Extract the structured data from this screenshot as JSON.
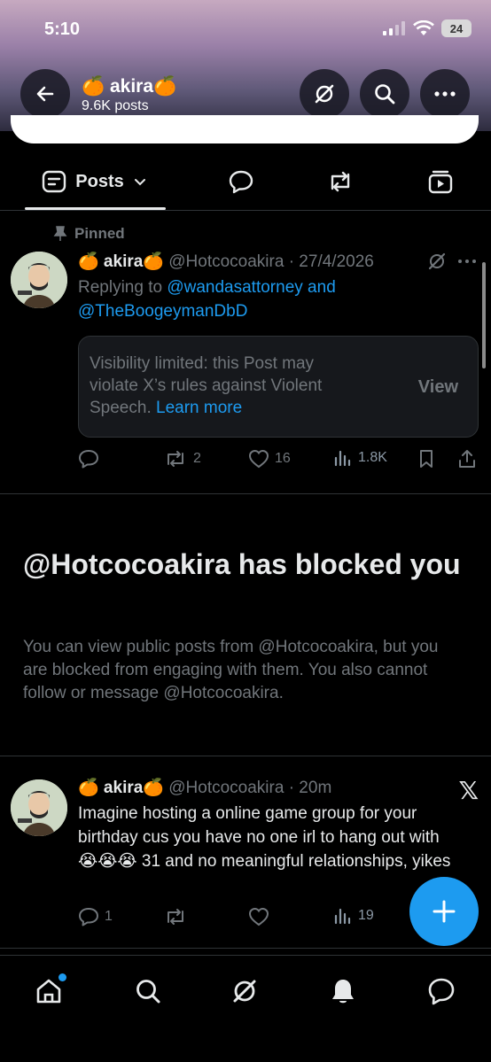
{
  "status_bar": {
    "time": "5:10",
    "battery": "24"
  },
  "header": {
    "name": "🍊 akira🍊",
    "posts_count": "9.6K posts"
  },
  "tabs": {
    "posts_label": "Posts"
  },
  "pinned_post": {
    "pinned_label": "Pinned",
    "display_name": "🍊 akira🍊",
    "handle_date": "@Hotcocoakira · 27/4/2026",
    "replying_prefix": "Replying to ",
    "reply_mention_1": "@wandasattorney",
    "reply_and": " and",
    "reply_mention_2": "@TheBoogeymanDbD",
    "limited_text": "Visibility limited: this Post may violate X’s rules against Violent Speech.",
    "learn_more": "Learn more",
    "view_label": "View",
    "reposts": "2",
    "likes": "16",
    "views": "1.8K"
  },
  "blocked": {
    "title": "@Hotcocoakira has blocked you",
    "text": "You can view public posts from @Hotcocoakira, but you are blocked from engaging with them. You also cannot follow or message @Hotcocoakira."
  },
  "second_post": {
    "display_name": "🍊 akira🍊",
    "handle_time": "@Hotcocoakira · 20m",
    "text": "Imagine hosting a online game group for your birthday cus you have no one irl to hang out with 😭😭😭 31 and no meaningful relationships, yikes",
    "replies": "1",
    "views": "19",
    "x_logo": "𝕏"
  },
  "icons": {
    "back": "arrow-left-icon",
    "grok": "grok-icon",
    "search": "search-icon",
    "more": "more-icon",
    "home": "home-icon",
    "notifications": "bell-icon",
    "messages": "message-icon"
  },
  "colors": {
    "accent": "#1d9bf0",
    "muted": "#71767b",
    "text": "#e7e9ea",
    "border": "#2f3336"
  }
}
